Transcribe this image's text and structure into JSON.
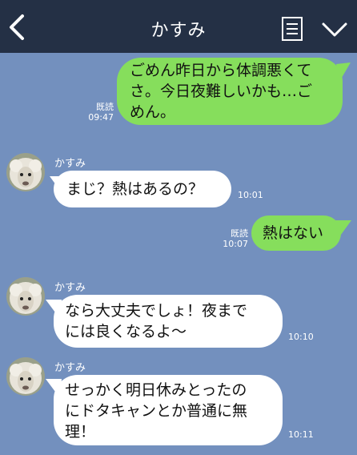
{
  "header": {
    "title": "かすみ",
    "back_icon": "chevron-left-icon",
    "menu_icon": "document-list-icon",
    "collapse_icon": "chevron-down-icon"
  },
  "colors": {
    "background": "#7390be",
    "header": "#243045",
    "my_bubble": "#86de5c",
    "their_bubble": "#ffffff"
  },
  "messages": [
    {
      "from": "me",
      "text": "ごめん昨日から体調悪くてさ。今日夜難しいかも…ごめん。",
      "lines": [
        "ごめん昨日から体調悪くて",
        "さ。今日夜難しいかも…ご",
        "めん。"
      ],
      "read": "既読",
      "time": "09:47"
    },
    {
      "from": "them",
      "sender": "かすみ",
      "text": "まじ？熱はあるの？",
      "lines": [
        "まじ？熱はあるの？"
      ],
      "time": "10:01"
    },
    {
      "from": "me",
      "text": "熱はない",
      "lines": [
        "熱はない"
      ],
      "read": "既読",
      "time": "10:07"
    },
    {
      "from": "them",
      "sender": "かすみ",
      "text": "なら大丈夫でしょ！夜までには良くなるよ〜",
      "lines": [
        "なら大丈夫でしょ！夜まで",
        "には良くなるよ〜"
      ],
      "time": "10:10"
    },
    {
      "from": "them",
      "sender": "かすみ",
      "text": "せっかく明日休みとったのにドタキャンとか普通に無理！",
      "lines": [
        "せっかく明日休みとったの",
        "にドタキャンとか普通に無",
        "理！"
      ],
      "time": "10:11"
    }
  ]
}
